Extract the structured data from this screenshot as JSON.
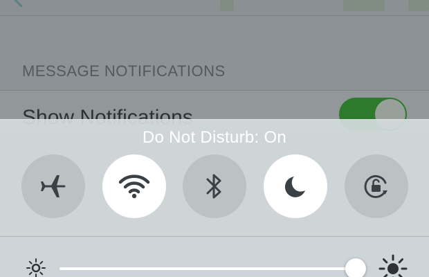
{
  "background_page": {
    "section_header": "MESSAGE NOTIFICATIONS",
    "row_label": "Show Notifications",
    "row_toggle_on": true,
    "toggle_color": "#2e7a2c"
  },
  "control_center": {
    "status_text": "Do Not Disturb: On",
    "toggles": [
      {
        "name": "airplane-mode",
        "icon": "airplane-icon",
        "on": false
      },
      {
        "name": "wifi",
        "icon": "wifi-icon",
        "on": true
      },
      {
        "name": "bluetooth",
        "icon": "bluetooth-icon",
        "on": false
      },
      {
        "name": "do-not-disturb",
        "icon": "moon-icon",
        "on": true
      },
      {
        "name": "rotation-lock",
        "icon": "rotation-lock-icon",
        "on": false
      }
    ],
    "brightness": {
      "value": 0.99,
      "min_icon": "sun-small-icon",
      "max_icon": "sun-large-icon"
    },
    "colors": {
      "button_on": "#ffffff",
      "button_off": "#bcc2c4",
      "icon": "#3b4045"
    }
  }
}
